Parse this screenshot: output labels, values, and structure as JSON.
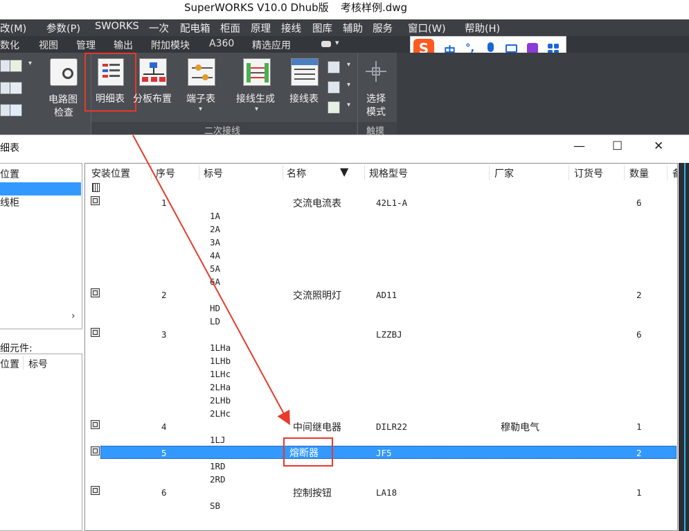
{
  "window": {
    "title": "SuperWORKS V10.0 Dhub版",
    "file": "考核样例.dwg"
  },
  "menu": [
    "改(M)",
    "参数(P)",
    "SWORKS",
    "一次",
    "配电箱",
    "柜面",
    "原理",
    "接线",
    "图库",
    "辅助",
    "服务",
    "窗口(W)",
    "帮助(H)"
  ],
  "tabs": [
    "数化",
    "视图",
    "管理",
    "输出",
    "附加模块",
    "A360",
    "精选应用"
  ],
  "ime": {
    "lang": "中",
    "punct": "°,"
  },
  "ribbon": {
    "circuit_check": "电路图检查",
    "circuit_check_l1": "电路图",
    "circuit_check_l2": "检查",
    "detail_table": "明细表",
    "board_layout": "分板布置",
    "terminal_table": "端子表",
    "wiring_gen": "接线生成",
    "wiring_table": "接线表",
    "select_mode_l1": "选择",
    "select_mode_l2": "模式",
    "group_secondary": "二次接线",
    "group_touch": "触摸"
  },
  "dialog": {
    "title": "细表",
    "left_top_header": "位置",
    "left_items": [
      "",
      "线柜"
    ],
    "left_bottom_title": "细元件:",
    "left_bottom_cols": [
      "位置",
      "标号"
    ],
    "columns": [
      "安装位置",
      "序号",
      "标号",
      "名称",
      "规格型号",
      "厂家",
      "订货号",
      "数量",
      "备"
    ]
  },
  "rows": [
    {
      "seq": "1",
      "name": "交流电流表",
      "model": "42L1-A",
      "maker": "",
      "qty": "6",
      "tags": [
        "1A",
        "2A",
        "3A",
        "4A",
        "5A",
        "6A"
      ]
    },
    {
      "seq": "2",
      "name": "交流照明灯",
      "model": "AD11",
      "maker": "",
      "qty": "2",
      "tags": [
        "HD",
        "LD"
      ]
    },
    {
      "seq": "3",
      "name": "",
      "model": "LZZBJ",
      "maker": "",
      "qty": "6",
      "tags": [
        "1LHa",
        "1LHb",
        "1LHc",
        "2LHa",
        "2LHb",
        "2LHc"
      ]
    },
    {
      "seq": "4",
      "name": "中间继电器",
      "model": "DILR22",
      "maker": "穆勒电气",
      "qty": "1",
      "tags": [
        "1LJ"
      ]
    },
    {
      "seq": "5",
      "name": "熔断器",
      "model": "JF5",
      "maker": "",
      "qty": "2",
      "tags": [
        "1RD",
        "2RD"
      ]
    },
    {
      "seq": "6",
      "name": "控制按钮",
      "model": "LA18",
      "maker": "",
      "qty": "1",
      "tags": [
        "SB"
      ]
    }
  ],
  "colors": {
    "selection": "#3399ff",
    "highlight": "#e8392b",
    "menubar": "#3c3f44"
  }
}
